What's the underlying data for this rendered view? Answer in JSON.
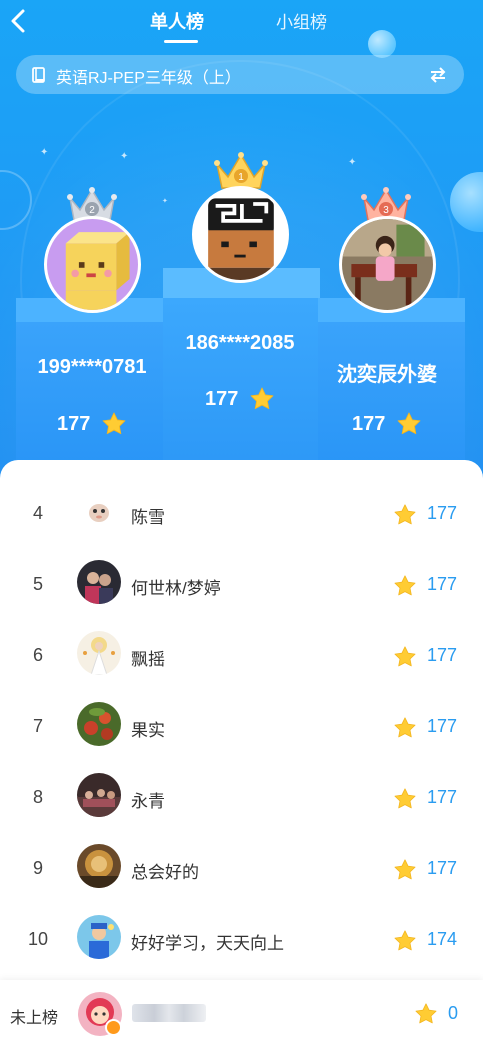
{
  "header": {
    "tabs": [
      {
        "label": "单人榜",
        "active": true
      },
      {
        "label": "小组榜",
        "active": false
      }
    ],
    "book_title": "英语RJ-PEP三年级（上）"
  },
  "colors": {
    "accent": "#1e9cf5",
    "score_text": "#2a9cf0",
    "star": "#ffcc33"
  },
  "top3": [
    {
      "rank": "1",
      "name": "186****2085",
      "score": "177"
    },
    {
      "rank": "2",
      "name": "199****0781",
      "score": "177"
    },
    {
      "rank": "3",
      "name": "沈奕辰外婆",
      "score": "177"
    }
  ],
  "ranking": [
    {
      "rank": "4",
      "name": "陈雪",
      "score": "177"
    },
    {
      "rank": "5",
      "name": "何世林/梦婷",
      "score": "177"
    },
    {
      "rank": "6",
      "name": "飘摇",
      "score": "177"
    },
    {
      "rank": "7",
      "name": "果实",
      "score": "177"
    },
    {
      "rank": "8",
      "name": "永青",
      "score": "177"
    },
    {
      "rank": "9",
      "name": "总会好的",
      "score": "177"
    },
    {
      "rank": "10",
      "name": "好好学习，天天向上",
      "score": "174"
    }
  ],
  "me": {
    "label": "未上榜",
    "score": "0"
  }
}
